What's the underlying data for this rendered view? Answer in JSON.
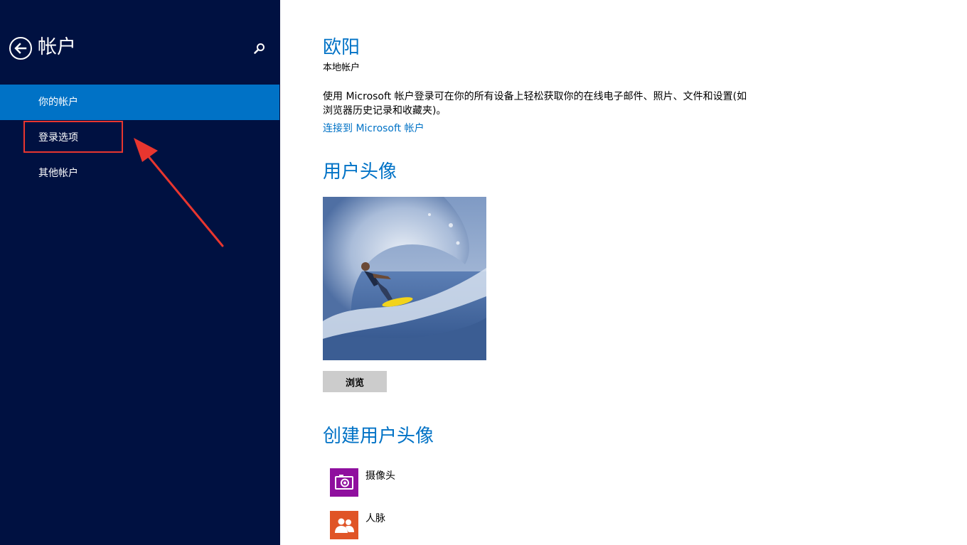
{
  "sidebar": {
    "title": "帐户",
    "nav_items": [
      {
        "label": "你的帐户",
        "active": true
      },
      {
        "label": "登录选项",
        "active": false
      },
      {
        "label": "其他帐户",
        "active": false
      }
    ],
    "icons": {
      "back": "back-arrow-icon",
      "search": "search-icon"
    }
  },
  "main": {
    "user_name": "欧阳",
    "account_type": "本地帐户",
    "description": "使用 Microsoft 帐户登录可在你的所有设备上轻松获取你的在线电子邮件、照片、文件和设置(如浏览器历史记录和收藏夹)。",
    "connect_link": "连接到 Microsoft 帐户",
    "avatar_section_title": "用户头像",
    "browse_button": "浏览",
    "create_section_title": "创建用户头像",
    "create_options": [
      {
        "label": "摄像头",
        "icon": "camera-icon",
        "color": "#8f0f9e"
      },
      {
        "label": "人脉",
        "icon": "people-icon",
        "color": "#e05426"
      }
    ]
  },
  "colors": {
    "sidebar_bg": "#001141",
    "active_item": "#0072c6",
    "accent": "#0072c6",
    "annotation": "#e8362f",
    "button_bg": "#cccccc"
  }
}
